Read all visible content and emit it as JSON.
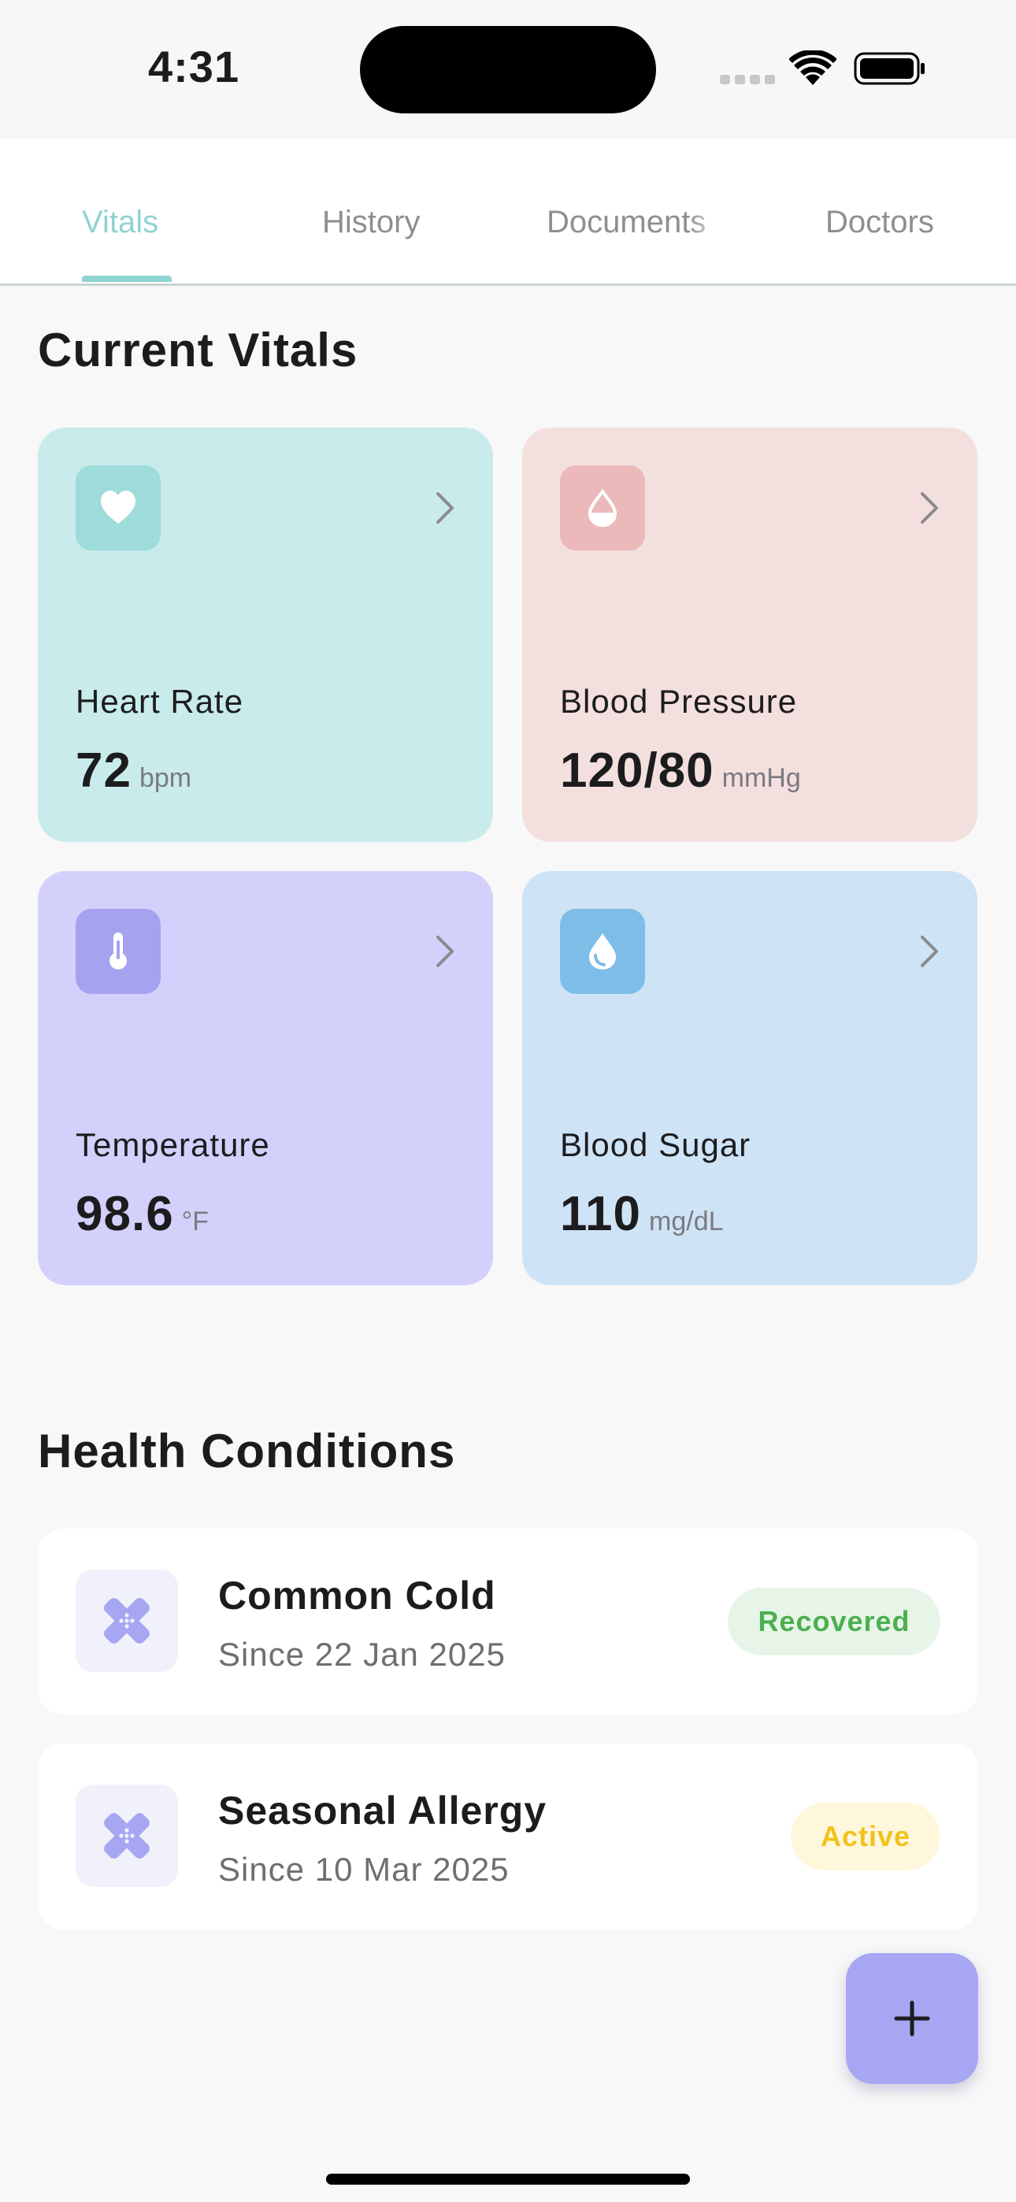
{
  "status_bar": {
    "time": "4:31"
  },
  "tabs": [
    {
      "label": "Vitals",
      "active": true
    },
    {
      "label": "History",
      "active": false
    },
    {
      "label": "Documents",
      "active": false
    },
    {
      "label": "Doctors",
      "active": false
    }
  ],
  "vitals": {
    "title": "Current Vitals",
    "cards": [
      {
        "label": "Heart Rate",
        "value": "72",
        "unit": "bpm",
        "icon": "heart-icon",
        "bg": "#c9ebeb",
        "icon_bg": "#9ddcdb"
      },
      {
        "label": "Blood Pressure",
        "value": "120/80",
        "unit": "mmHg",
        "icon": "half-drop-icon",
        "bg": "#f4dfdf",
        "icon_bg": "#ebb9b9"
      },
      {
        "label": "Temperature",
        "value": "98.6",
        "unit": "°F",
        "icon": "thermometer-icon",
        "bg": "#d3d1fb",
        "icon_bg": "#a5a2ef"
      },
      {
        "label": "Blood Sugar",
        "value": "110",
        "unit": "mg/dL",
        "icon": "water-drop-icon",
        "bg": "#cfe3f6",
        "icon_bg": "#7dbde8"
      }
    ]
  },
  "conditions": {
    "title": "Health Conditions",
    "items": [
      {
        "name": "Common Cold",
        "since": "Since 22 Jan 2025",
        "status": "Recovered",
        "status_color": "#4caf50",
        "status_bg": "#e7f5e8",
        "icon": "bandage-icon"
      },
      {
        "name": "Seasonal Allergy",
        "since": "Since 10 Mar 2025",
        "status": "Active",
        "status_color": "#f2c21b",
        "status_bg": "#fff7dc",
        "icon": "bandage-icon"
      }
    ]
  },
  "fab": {
    "icon": "plus-icon",
    "color": "#a6a6f3"
  }
}
